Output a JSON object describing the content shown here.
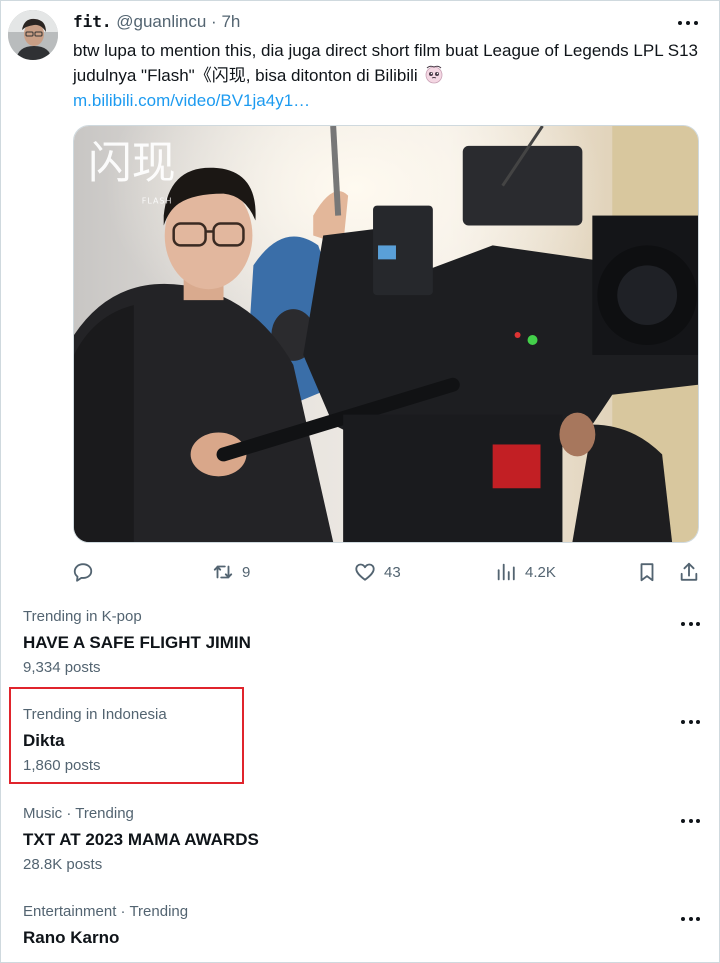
{
  "tweet": {
    "author_name": "fit.",
    "author_handle": "@guanlincu",
    "separator": "·",
    "time": "7h",
    "text": "btw lupa to mention this, dia juga direct short film buat League of Legends LPL S13 judulnya \"Flash\"《闪现, bisa ditonton di Bilibili",
    "emoji": "pleading-face-emoji",
    "link": "m.bilibili.com/video/BV1ja4y1…",
    "media_caption": "闪现",
    "media_caption_sub": "FLASH",
    "icons": {
      "avatar": "avatar-image",
      "more": "more-dots-icon",
      "reply": "reply-icon",
      "retweet": "retweet-icon",
      "like": "heart-icon",
      "views": "views-chart-icon",
      "bookmark": "bookmark-icon",
      "share": "share-icon"
    },
    "actions": {
      "reply_count": "",
      "retweet_count": "9",
      "like_count": "43",
      "views_count": "4.2K"
    }
  },
  "trends": [
    {
      "context": "Trending in K-pop",
      "title": "HAVE A SAFE FLIGHT JIMIN",
      "posts": "9,334 posts"
    },
    {
      "context": "Trending in Indonesia",
      "title": "Dikta",
      "posts": "1,860 posts"
    },
    {
      "context": "Music · Trending",
      "title": "TXT AT 2023 MAMA AWARDS",
      "posts": "28.8K posts"
    },
    {
      "context": "Entertainment · Trending",
      "title": "Rano Karno",
      "posts": ""
    }
  ],
  "colors": {
    "text": "#0f1419",
    "secondary": "#536471",
    "link": "#1d9bf0",
    "highlight_box": "#e0242c"
  }
}
